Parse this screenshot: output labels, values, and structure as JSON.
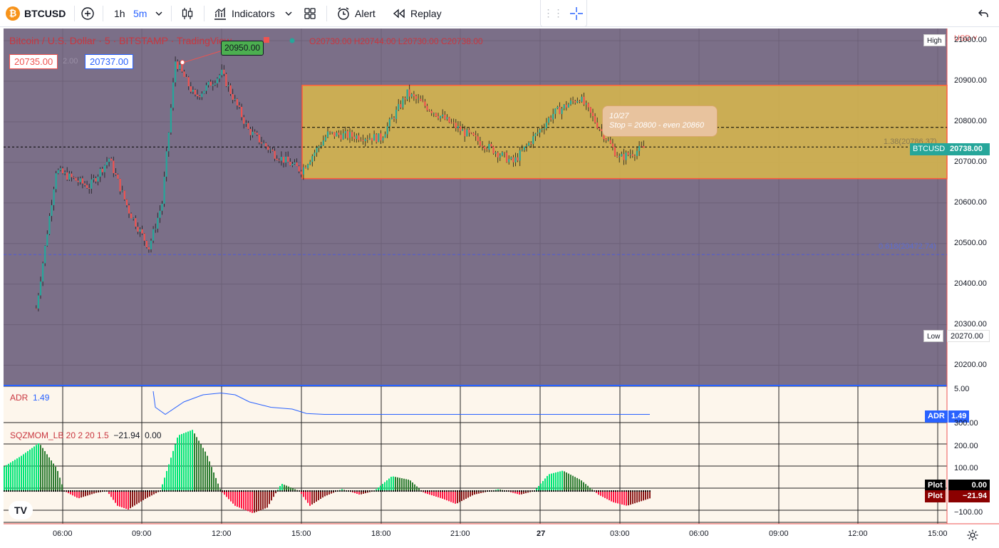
{
  "toolbar": {
    "symbol": "BTCUSD",
    "symbol_icon": "bitcoin-icon",
    "intervals": [
      "1h",
      "5m"
    ],
    "indicators_label": "Indicators",
    "alert_label": "Alert",
    "replay_label": "Replay"
  },
  "legend": {
    "title": "Bitcoin / U.S. Dollar · 5 · BITSTAMP · TradingView",
    "open": "O20730.00",
    "high": "H20744.00",
    "low": "L20730.00",
    "close": "C20738.00",
    "sell_price": "20735.00",
    "spread": "2.00",
    "buy_price": "20737.00"
  },
  "annotations": {
    "price_callout": "20950.00",
    "note_line1": "10/27",
    "note_line2": "Stop = 20800 - even 20860",
    "fib_138": "1.38(20786.37)",
    "fib_0618": "0.618(20472.74)"
  },
  "price_axis": {
    "currency": "USD",
    "ticks": [
      "21000.00",
      "20900.00",
      "20800.00",
      "20700.00",
      "20600.00",
      "20500.00",
      "20400.00",
      "20300.00",
      "20200.00"
    ],
    "high_label": "High",
    "low_label": "Low",
    "low_value": "20270.00",
    "current_symbol": "BTCUSD",
    "current_value": "20738.00"
  },
  "adr": {
    "label": "ADR",
    "value": "1.49",
    "axis_top": "5.00",
    "tag_label": "ADR",
    "tag_value": "1.49"
  },
  "sqz": {
    "label": "SQZMOM_LB 20 2 20 1.5",
    "v1": "−21.94",
    "v2": "0.00",
    "ticks": [
      "300.00",
      "200.00",
      "100.00",
      "−100.00"
    ],
    "plot1_label": "Plot",
    "plot1_value": "0.00",
    "plot2_label": "Plot",
    "plot2_value": "−21.94"
  },
  "time_axis": [
    "06:00",
    "09:00",
    "12:00",
    "15:00",
    "18:00",
    "21:00",
    "27",
    "03:00",
    "06:00",
    "09:00",
    "12:00",
    "15:00"
  ],
  "colors": {
    "up": "#26a69a",
    "down": "#ef5350",
    "bg_main": "#7b6f88",
    "box": "#d9b84b",
    "accent": "#2962ff"
  },
  "chart_data": {
    "type": "candlestick",
    "interval": "5m",
    "symbol": "BTCUSD",
    "ylim": [
      20150,
      21030
    ],
    "last": {
      "open": 20730,
      "high": 20744,
      "low": 20730,
      "close": 20738
    },
    "levels": {
      "fib_1_38": 20786.37,
      "fib_0_618": 20472.74,
      "range_top": 20890,
      "range_bottom": 20660
    },
    "session_high": 20950,
    "session_low": 20270,
    "path_keypoints": [
      {
        "t": "05:00",
        "p": 20340
      },
      {
        "t": "05:45",
        "p": 20680
      },
      {
        "t": "07:00",
        "p": 20640
      },
      {
        "t": "07:45",
        "p": 20710
      },
      {
        "t": "08:30",
        "p": 20580
      },
      {
        "t": "09:15",
        "p": 20490
      },
      {
        "t": "09:45",
        "p": 20600
      },
      {
        "t": "10:15",
        "p": 20950
      },
      {
        "t": "11:00",
        "p": 20860
      },
      {
        "t": "12:00",
        "p": 20920
      },
      {
        "t": "13:00",
        "p": 20780
      },
      {
        "t": "14:00",
        "p": 20720
      },
      {
        "t": "15:00",
        "p": 20680
      },
      {
        "t": "16:00",
        "p": 20770
      },
      {
        "t": "18:00",
        "p": 20760
      },
      {
        "t": "19:00",
        "p": 20870
      },
      {
        "t": "21:00",
        "p": 20780
      },
      {
        "t": "23:00",
        "p": 20700
      },
      {
        "t": "00:30",
        "p": 20820
      },
      {
        "t": "01:30",
        "p": 20860
      },
      {
        "t": "03:00",
        "p": 20710
      },
      {
        "t": "04:00",
        "p": 20738
      }
    ]
  }
}
